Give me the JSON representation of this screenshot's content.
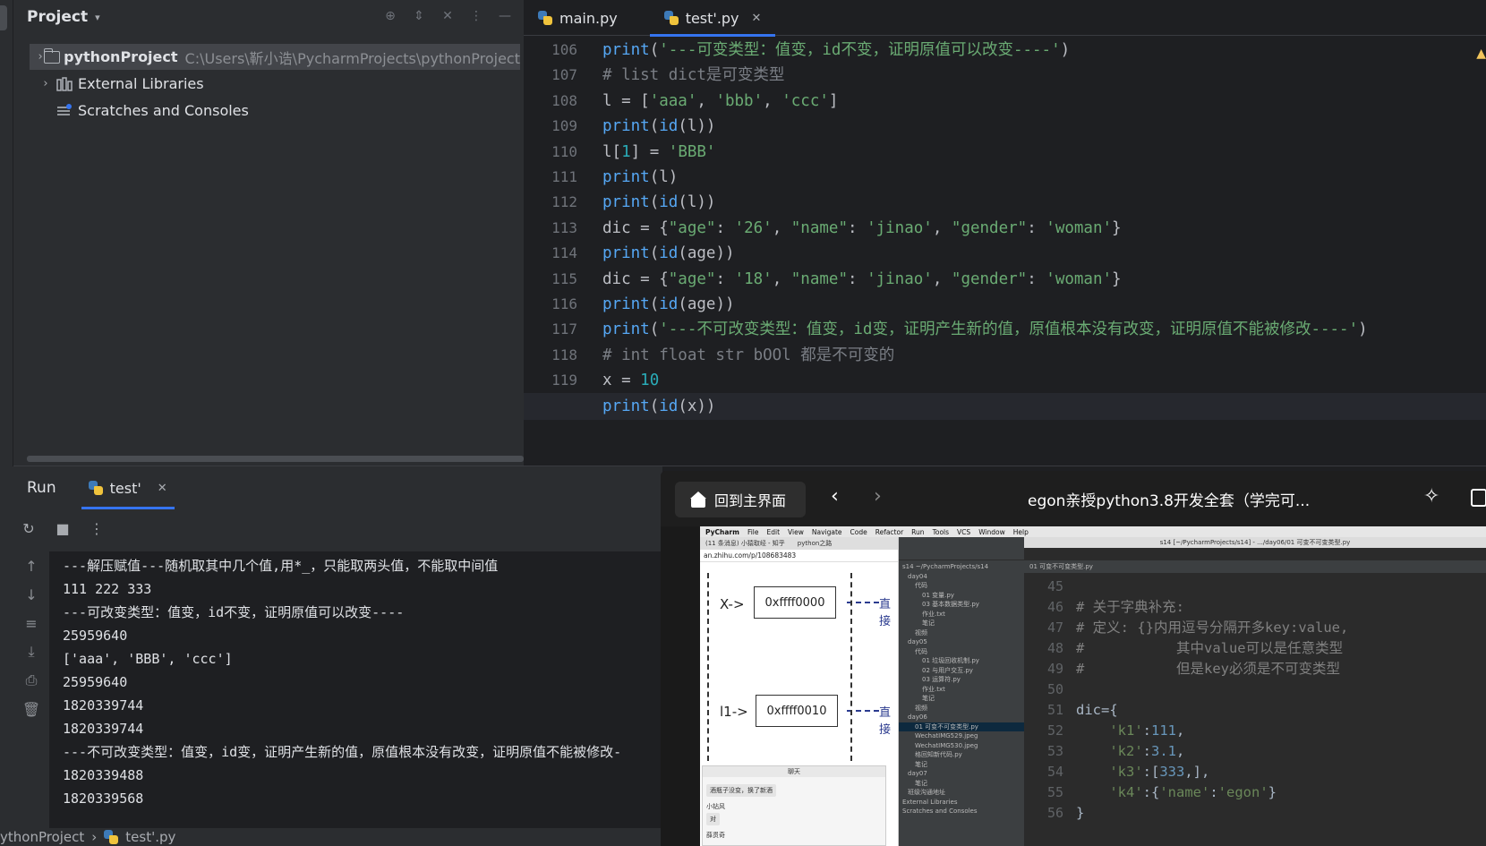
{
  "project_panel": {
    "title": "Project",
    "tree": [
      {
        "name": "pythonProject",
        "path": "C:\\Users\\靳小诰\\PycharmProjects\\pythonProject"
      },
      {
        "name": "External Libraries"
      },
      {
        "name": "Scratches and Consoles"
      }
    ]
  },
  "editor": {
    "tabs": [
      {
        "label": "main.py",
        "active": false
      },
      {
        "label": "test'.py",
        "active": true
      }
    ],
    "current_line": 120,
    "lines": [
      {
        "num": "106",
        "text": "print('---可变类型：值变，id不变，证明原值可以改变----')"
      },
      {
        "num": "107",
        "text": "# list dict是可变类型"
      },
      {
        "num": "108",
        "text": "l = ['aaa', 'bbb', 'ccc']"
      },
      {
        "num": "109",
        "text": "print(id(l))"
      },
      {
        "num": "110",
        "text": "l[1] = 'BBB'"
      },
      {
        "num": "111",
        "text": "print(l)"
      },
      {
        "num": "112",
        "text": "print(id(l))"
      },
      {
        "num": "113",
        "text": "dic = {\"age\": '26', \"name\": 'jinao', \"gender\": 'woman'}"
      },
      {
        "num": "114",
        "text": "print(id(age))"
      },
      {
        "num": "115",
        "text": "dic = {\"age\": '18', \"name\": 'jinao', \"gender\": 'woman'}"
      },
      {
        "num": "116",
        "text": "print(id(age))"
      },
      {
        "num": "117",
        "text": "print('---不可改变类型：值变，id变，证明产生新的值，原值根本没有改变，证明原值不能被修改----')"
      },
      {
        "num": "118",
        "text": "# int float str bOOl 都是不可变的"
      },
      {
        "num": "119",
        "text": "x = 10"
      },
      {
        "num": "120",
        "text": "print(id(x))"
      }
    ]
  },
  "run_panel": {
    "title": "Run",
    "tab_label": "test'",
    "output": [
      "---解压赋值---随机取其中几个值,用*_，只能取两头值，不能取中间值",
      "111 222 333",
      "---可改变类型：值变，id不变，证明原值可以改变----",
      "25959640",
      "['aaa', 'BBB', 'ccc']",
      "25959640",
      "1820339744",
      "1820339744",
      "---不可改变类型：值变，id变，证明产生新的值，原值根本没有改变，证明原值不能被修改-",
      "1820339488",
      "1820339568"
    ]
  },
  "status_bar": {
    "project": "ythonProject",
    "file": "test'.py"
  },
  "video_overlay": {
    "home_label": "回到主界面",
    "title": "egon亲授python3.8开发全套（学完可...",
    "mac_menu": [
      "PyCharm",
      "File",
      "Edit",
      "View",
      "Navigate",
      "Code",
      "Refactor",
      "Run",
      "Tools",
      "VCS",
      "Window",
      "Help"
    ],
    "window_path": "s14 [~/PycharmProjects/s14] - .../day06/01 可变不可变类型.py",
    "browser_url": "an.zhihu.com/p/108683483",
    "browser_tabs": [
      "(11 条消息) 小猿取经 - 知乎",
      "python之路"
    ],
    "diagram": {
      "x_label": "X->",
      "x_box": "0xffff0000",
      "l1_label": "l1->",
      "l1_box": "0xffff0010",
      "arrow_text": "直接"
    },
    "chat": {
      "title": "聊天",
      "msg1": "酒瓶子没变，换了新酒",
      "sender": "小钻风",
      "reply": "对",
      "sender2": "薛贯奇"
    },
    "pycharm_tree": [
      "s14 ~/PycharmProjects/s14",
      "day04",
      "代码",
      "01 变量.py",
      "03 基本数据类型.py",
      "作业.txt",
      "笔记",
      "视频",
      "day05",
      "代码",
      "01 垃圾回收机制.py",
      "02 与用户交互.py",
      "03 运算符.py",
      "作业.txt",
      "笔记",
      "视频",
      "day06",
      "01 可变不可变类型.py",
      "WechatIMG529.jpeg",
      "WechatIMG530.jpeg",
      "格回知新代码.py",
      "笔记",
      "day07",
      "笔记",
      "班级沟通地址",
      "External Libraries",
      "Scratches and Consoles"
    ],
    "pycharm_tab": "01 可变不可变类型.py",
    "pycharm_lines": [
      {
        "num": "45",
        "text": ""
      },
      {
        "num": "46",
        "text": "# 关于字典补充:"
      },
      {
        "num": "47",
        "text": "# 定义: {}内用逗号分隔开多key:value,"
      },
      {
        "num": "48",
        "text": "#           其中value可以是任意类型"
      },
      {
        "num": "49",
        "text": "#           但是key必须是不可变类型"
      },
      {
        "num": "50",
        "text": ""
      },
      {
        "num": "51",
        "text": "dic={"
      },
      {
        "num": "52",
        "text": "    'k1':111,"
      },
      {
        "num": "53",
        "text": "    'k2':3.1,"
      },
      {
        "num": "54",
        "text": "    'k3':[333,],"
      },
      {
        "num": "55",
        "text": "    'k4':{'name':'egon'}"
      },
      {
        "num": "56",
        "text": "}"
      }
    ]
  }
}
